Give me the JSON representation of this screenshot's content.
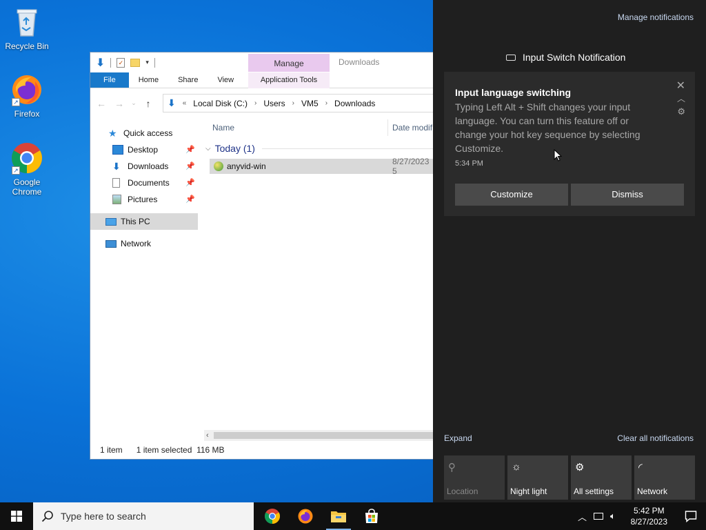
{
  "desktop": {
    "icons": [
      {
        "label": "Recycle Bin"
      },
      {
        "label": "Firefox"
      },
      {
        "label": "Google Chrome"
      }
    ]
  },
  "explorer": {
    "context_tab": "Manage",
    "context_title": "Downloads",
    "ribbon_tabs": [
      "File",
      "Home",
      "Share",
      "View",
      "Application Tools"
    ],
    "breadcrumb_prefix": "«",
    "breadcrumb": [
      "Local Disk (C:)",
      "Users",
      "VM5",
      "Downloads"
    ],
    "nav": {
      "quick_access": "Quick access",
      "items": [
        "Desktop",
        "Downloads",
        "Documents",
        "Pictures"
      ],
      "this_pc": "This PC",
      "network": "Network"
    },
    "columns": {
      "name": "Name",
      "date": "Date modif"
    },
    "group": "Today (1)",
    "file": {
      "name": "anyvid-win",
      "date": "8/27/2023 5"
    },
    "status": {
      "count": "1 item",
      "selected": "1 item selected",
      "size": "116 MB"
    }
  },
  "action_center": {
    "manage": "Manage notifications",
    "header": "Input Switch Notification",
    "toast": {
      "title": "Input language switching",
      "body": "Typing Left Alt + Shift changes your input language. You can turn this feature off or change your hot key sequence by selecting Customize.",
      "time": "5:34 PM",
      "customize": "Customize",
      "dismiss": "Dismiss"
    },
    "expand": "Expand",
    "clear_all": "Clear all notifications",
    "quick_actions": [
      {
        "label": "Location",
        "icon": "location-icon",
        "enabled": false
      },
      {
        "label": "Night light",
        "icon": "night-light-icon",
        "enabled": true
      },
      {
        "label": "All settings",
        "icon": "settings-icon",
        "enabled": true
      },
      {
        "label": "Network",
        "icon": "network-icon",
        "enabled": true
      }
    ]
  },
  "taskbar": {
    "search_placeholder": "Type here to search",
    "time": "5:42 PM",
    "date": "8/27/2023"
  },
  "colors": {
    "accent": "#1979ca",
    "action_center_bg": "#1f1f1f",
    "toast_bg": "#2b2b2b",
    "taskbar_bg": "#101010"
  }
}
